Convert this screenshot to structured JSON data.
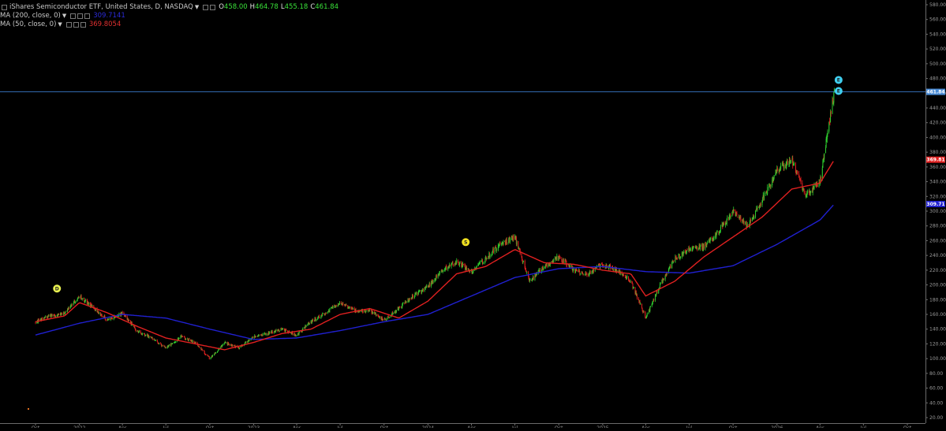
{
  "header": {
    "symbol_title": "iShares Semiconductor ETF, United States, D, NASDAQ",
    "ohlc": {
      "open_label": "O",
      "open": "458.00",
      "high_label": "H",
      "high": "464.78",
      "low_label": "L",
      "low": "455.18",
      "close_label": "C",
      "close": "461.84"
    },
    "indicators": [
      {
        "label": "MA (200, close, 0)",
        "value": "309.7141",
        "color": "#2b2bd9"
      },
      {
        "label": "MA (50, close, 0)",
        "value": "369.8054",
        "color": "#e03030"
      }
    ]
  },
  "colors": {
    "background": "#000000",
    "up_candle": "#2ecc2e",
    "down_candle": "#e02020",
    "ma200": "#2020d0",
    "ma50": "#e02020",
    "price_line": "#3a78c8",
    "price_tag": "#4a8cd6",
    "marker_dividend": "#e8f050",
    "marker_split": "#f0e020",
    "marker_earnings": "#40d0f0"
  },
  "chart_data": {
    "type": "candlestick",
    "title": "iShares Semiconductor ETF, United States, D, NASDAQ",
    "ylim": [
      20,
      580
    ],
    "yticks": [
      20,
      40,
      60,
      80,
      100,
      120,
      140,
      160,
      180,
      200,
      220,
      240,
      260,
      280,
      300,
      320,
      340,
      360,
      380,
      400,
      420,
      440,
      460,
      480,
      500,
      520,
      540,
      560,
      580
    ],
    "x_tick_labels": [
      "Oct",
      "2022",
      "Apr",
      "Jul",
      "Oct",
      "2023",
      "Apr",
      "Jul",
      "Oct",
      "2024",
      "Apr",
      "Jul",
      "Oct",
      "2025",
      "Apr",
      "Jul",
      "Oct",
      "2026",
      "Apr",
      "Jul",
      "Oct"
    ],
    "price_path": [
      [
        "2021-10-01",
        150
      ],
      [
        "2021-11-01",
        158
      ],
      [
        "2021-12-01",
        162
      ],
      [
        "2022-01-01",
        185
      ],
      [
        "2022-02-01",
        168
      ],
      [
        "2022-03-01",
        152
      ],
      [
        "2022-04-01",
        162
      ],
      [
        "2022-05-01",
        138
      ],
      [
        "2022-06-01",
        128
      ],
      [
        "2022-07-01",
        114
      ],
      [
        "2022-08-01",
        130
      ],
      [
        "2022-09-01",
        122
      ],
      [
        "2022-10-01",
        100
      ],
      [
        "2022-11-01",
        122
      ],
      [
        "2022-12-01",
        115
      ],
      [
        "2023-01-01",
        130
      ],
      [
        "2023-02-01",
        135
      ],
      [
        "2023-03-01",
        140
      ],
      [
        "2023-04-01",
        132
      ],
      [
        "2023-05-01",
        150
      ],
      [
        "2023-06-01",
        162
      ],
      [
        "2023-07-01",
        176
      ],
      [
        "2023-08-01",
        165
      ],
      [
        "2023-09-01",
        165
      ],
      [
        "2023-10-01",
        152
      ],
      [
        "2023-11-01",
        168
      ],
      [
        "2023-12-01",
        185
      ],
      [
        "2024-01-01",
        198
      ],
      [
        "2024-02-01",
        220
      ],
      [
        "2024-03-01",
        232
      ],
      [
        "2024-04-01",
        218
      ],
      [
        "2024-05-01",
        236
      ],
      [
        "2024-06-01",
        255
      ],
      [
        "2024-07-01",
        265
      ],
      [
        "2024-08-01",
        205
      ],
      [
        "2024-09-01",
        225
      ],
      [
        "2024-10-01",
        238
      ],
      [
        "2024-11-01",
        220
      ],
      [
        "2024-12-01",
        215
      ],
      [
        "2025-01-01",
        228
      ],
      [
        "2025-02-01",
        220
      ],
      [
        "2025-03-01",
        205
      ],
      [
        "2025-04-01",
        155
      ],
      [
        "2025-05-01",
        200
      ],
      [
        "2025-06-01",
        235
      ],
      [
        "2025-07-01",
        248
      ],
      [
        "2025-08-01",
        252
      ],
      [
        "2025-09-01",
        272
      ],
      [
        "2025-10-01",
        300
      ],
      [
        "2025-11-01",
        280
      ],
      [
        "2025-12-01",
        315
      ],
      [
        "2026-01-01",
        355
      ],
      [
        "2026-02-01",
        370
      ],
      [
        "2026-03-01",
        320
      ],
      [
        "2026-04-01",
        340
      ],
      [
        "2026-05-01",
        461.84
      ]
    ],
    "ma200_path": [
      [
        "2021-10-01",
        132
      ],
      [
        "2022-01-01",
        148
      ],
      [
        "2022-04-01",
        160
      ],
      [
        "2022-07-01",
        155
      ],
      [
        "2022-10-01",
        140
      ],
      [
        "2023-01-01",
        126
      ],
      [
        "2023-04-01",
        128
      ],
      [
        "2023-07-01",
        138
      ],
      [
        "2023-10-01",
        150
      ],
      [
        "2024-01-01",
        160
      ],
      [
        "2024-04-01",
        185
      ],
      [
        "2024-07-01",
        210
      ],
      [
        "2024-10-01",
        222
      ],
      [
        "2025-01-01",
        225
      ],
      [
        "2025-04-01",
        218
      ],
      [
        "2025-07-01",
        216
      ],
      [
        "2025-10-01",
        226
      ],
      [
        "2026-01-01",
        255
      ],
      [
        "2026-04-01",
        288
      ],
      [
        "2026-05-01",
        309.71
      ]
    ],
    "ma50_path": [
      [
        "2021-10-01",
        150
      ],
      [
        "2021-12-01",
        158
      ],
      [
        "2022-01-01",
        176
      ],
      [
        "2022-03-01",
        162
      ],
      [
        "2022-05-01",
        144
      ],
      [
        "2022-07-01",
        128
      ],
      [
        "2022-09-01",
        120
      ],
      [
        "2022-11-01",
        112
      ],
      [
        "2023-01-01",
        122
      ],
      [
        "2023-03-01",
        134
      ],
      [
        "2023-05-01",
        140
      ],
      [
        "2023-07-01",
        160
      ],
      [
        "2023-09-01",
        168
      ],
      [
        "2023-11-01",
        155
      ],
      [
        "2024-01-01",
        178
      ],
      [
        "2024-03-01",
        215
      ],
      [
        "2024-05-01",
        225
      ],
      [
        "2024-07-01",
        248
      ],
      [
        "2024-09-01",
        230
      ],
      [
        "2024-11-01",
        228
      ],
      [
        "2025-01-01",
        220
      ],
      [
        "2025-03-01",
        215
      ],
      [
        "2025-04-01",
        185
      ],
      [
        "2025-06-01",
        205
      ],
      [
        "2025-08-01",
        238
      ],
      [
        "2025-10-01",
        265
      ],
      [
        "2025-12-01",
        292
      ],
      [
        "2026-02-01",
        330
      ],
      [
        "2026-04-01",
        338
      ],
      [
        "2026-05-01",
        369.81
      ]
    ],
    "markers": [
      {
        "type": "dividend",
        "label": "D",
        "date": "2021-11-15",
        "price": 195
      },
      {
        "type": "split",
        "label": "S",
        "date": "2024-03-20",
        "price": 258
      },
      {
        "type": "earnings",
        "label": "E",
        "date": "2026-05-10",
        "price": 478
      },
      {
        "type": "earnings",
        "label": "E",
        "date": "2026-05-10",
        "price": 463
      }
    ],
    "price_tags": [
      {
        "label": "461.84",
        "price": 461.84,
        "color": "#4a8cd6"
      },
      {
        "label": "369.81",
        "price": 369.81,
        "color": "#e02020"
      },
      {
        "label": "309.71",
        "price": 309.71,
        "color": "#2020d0"
      }
    ],
    "current_price": 461.84
  }
}
